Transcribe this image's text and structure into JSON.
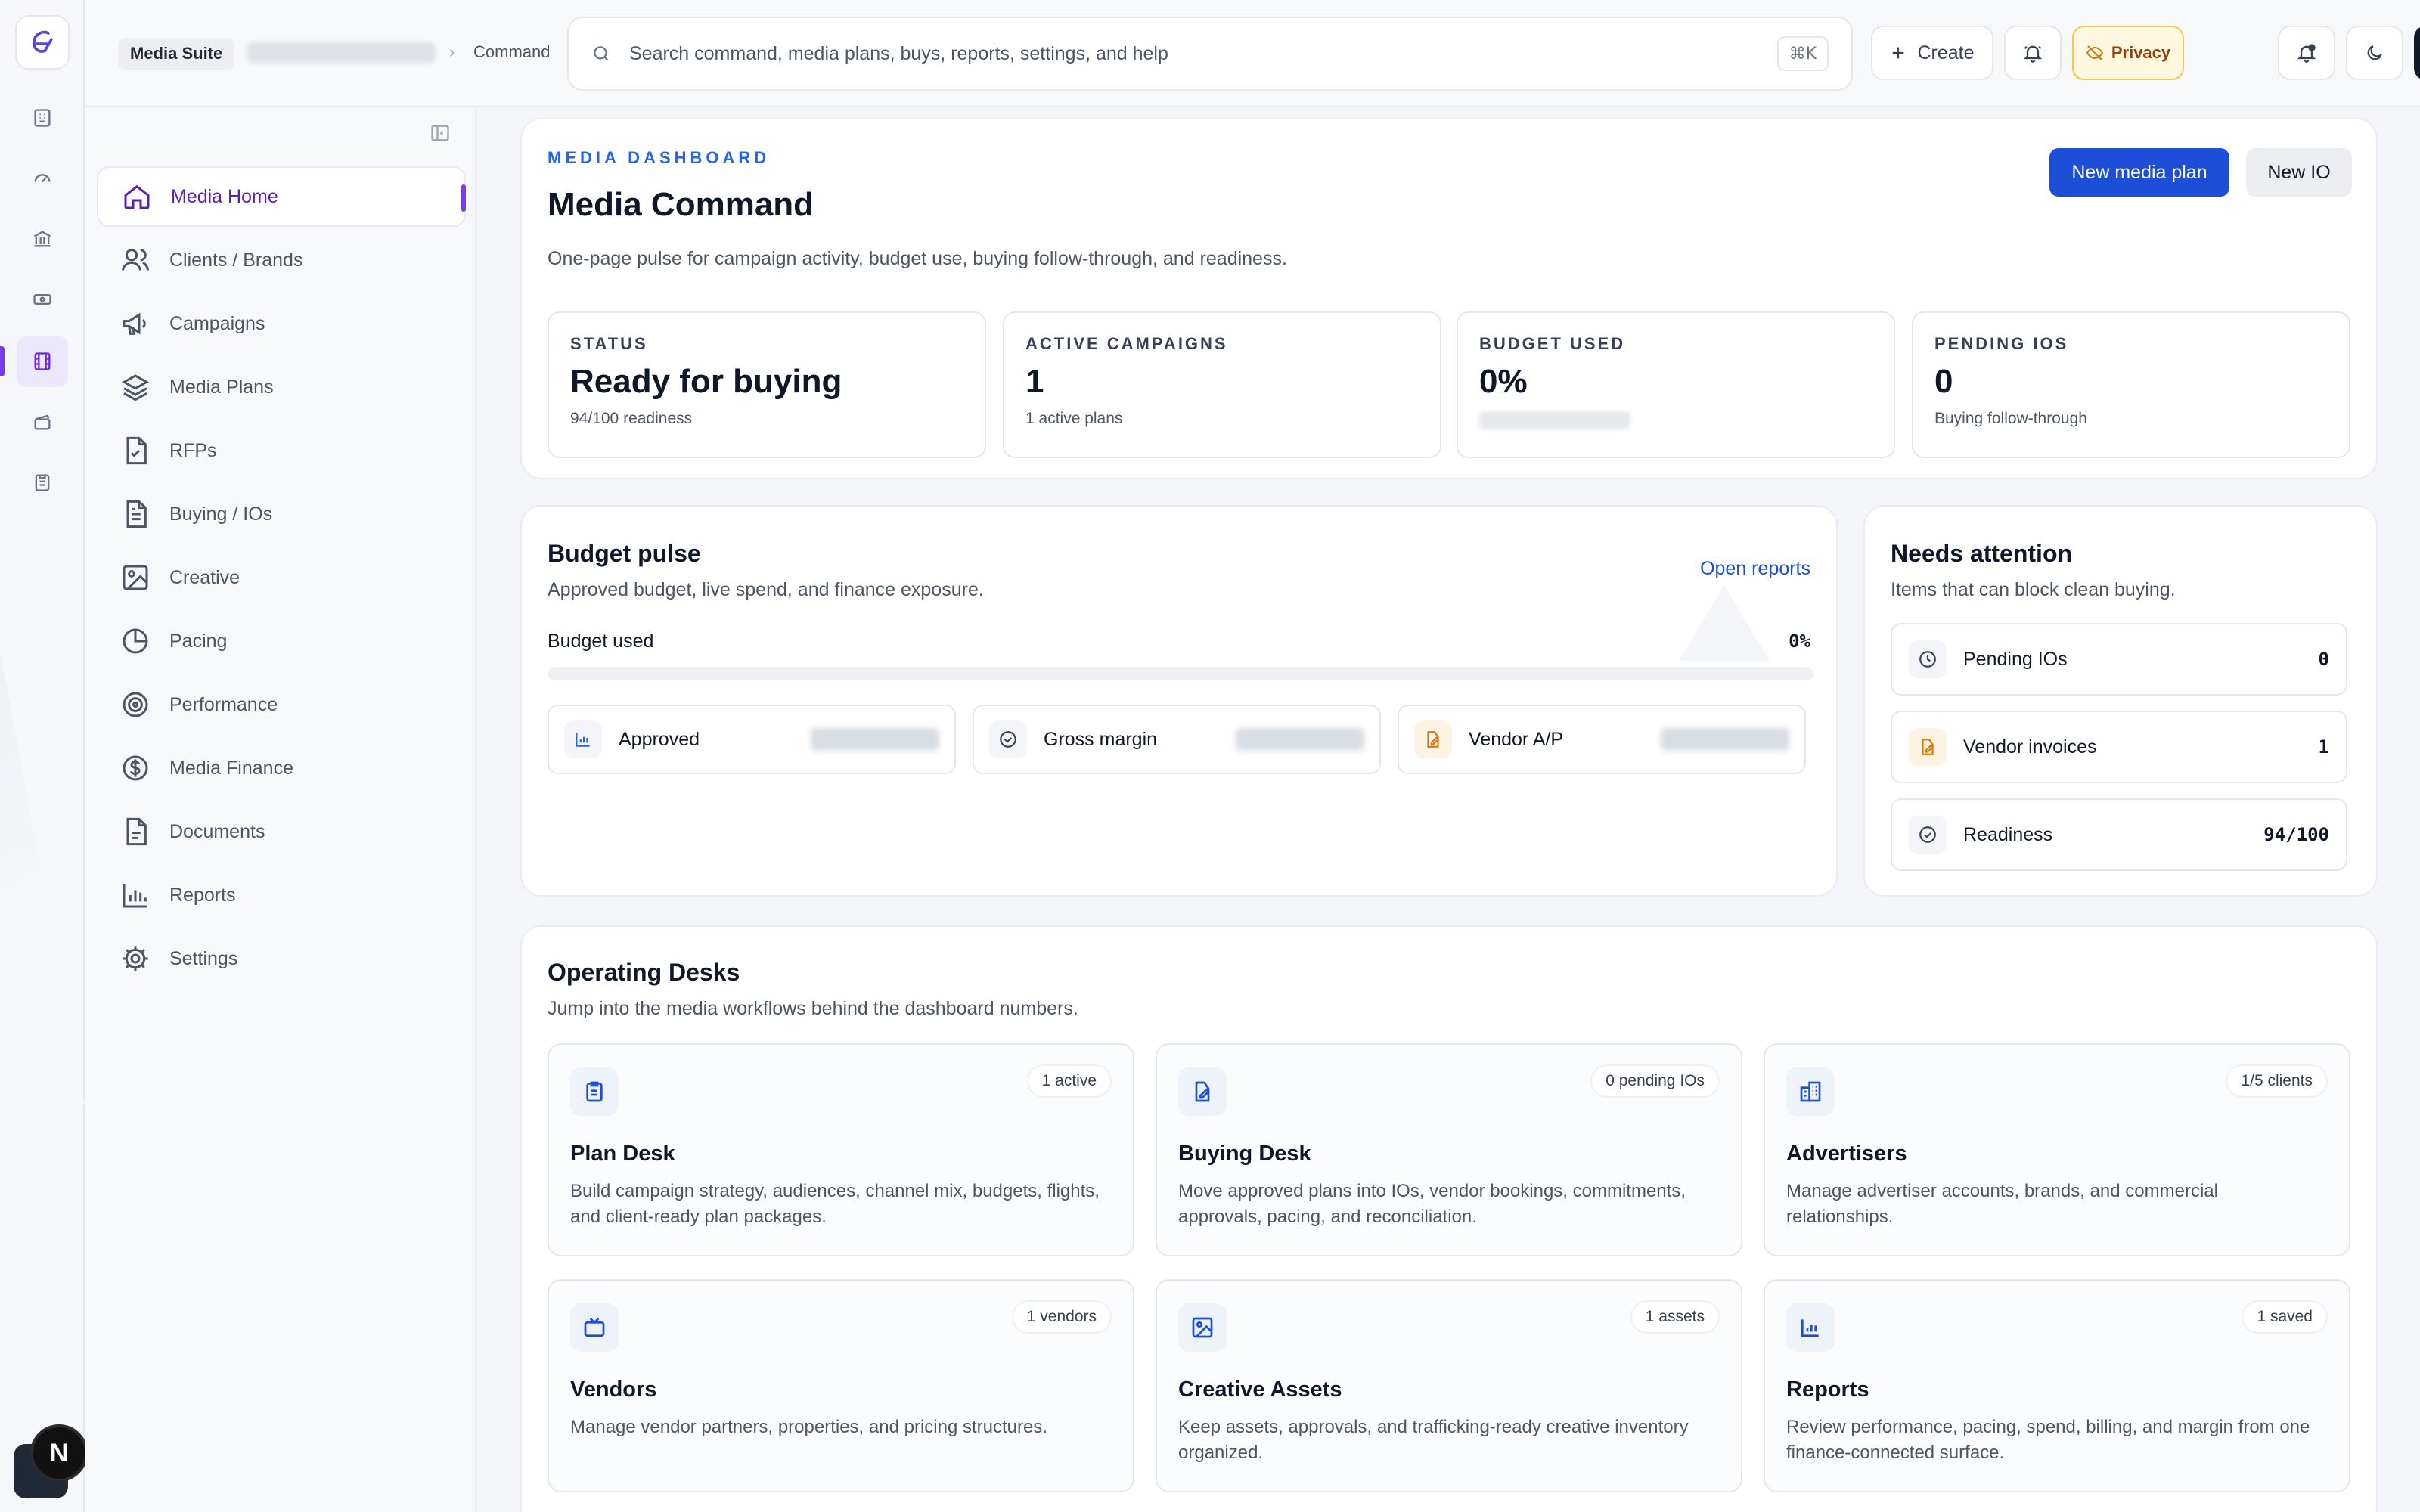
{
  "topbar": {
    "app_name": "Media Suite",
    "breadcrumb_separator": "›",
    "breadcrumb_current": "Command",
    "search_placeholder": "Search command, media plans, buys, reports, settings, and help",
    "search_shortcut": "⌘K",
    "create_label": "Create",
    "privacy_label": "Privacy"
  },
  "rail": {
    "icons": [
      "building-icon",
      "gauge-icon",
      "bank-icon",
      "ticket-icon",
      "film-icon",
      "clapperboard-icon",
      "clipboard-icon"
    ],
    "active_index": 4,
    "avatar_letter": "N"
  },
  "sidebar": {
    "items": [
      {
        "label": "Media Home",
        "icon": "home-icon",
        "active": true
      },
      {
        "label": "Clients / Brands",
        "icon": "users-icon"
      },
      {
        "label": "Campaigns",
        "icon": "megaphone-icon"
      },
      {
        "label": "Media Plans",
        "icon": "layers-icon"
      },
      {
        "label": "RFPs",
        "icon": "file-check-icon"
      },
      {
        "label": "Buying / IOs",
        "icon": "file-text-icon"
      },
      {
        "label": "Creative",
        "icon": "image-icon"
      },
      {
        "label": "Pacing",
        "icon": "pie-chart-icon"
      },
      {
        "label": "Performance",
        "icon": "target-icon"
      },
      {
        "label": "Media Finance",
        "icon": "dollar-icon"
      },
      {
        "label": "Documents",
        "icon": "document-icon"
      },
      {
        "label": "Reports",
        "icon": "bar-chart-icon"
      },
      {
        "label": "Settings",
        "icon": "gear-icon"
      }
    ]
  },
  "dashboard": {
    "eyebrow": "MEDIA DASHBOARD",
    "title": "Media Command",
    "subtitle": "One-page pulse for campaign activity, budget use, buying follow-through, and readiness.",
    "new_plan_label": "New media plan",
    "new_io_label": "New IO",
    "stats": [
      {
        "label": "STATUS",
        "value": "Ready for buying",
        "note": "94/100 readiness"
      },
      {
        "label": "ACTIVE CAMPAIGNS",
        "value": "1",
        "note": "1 active plans"
      },
      {
        "label": "BUDGET USED",
        "value": "0%",
        "note": ""
      },
      {
        "label": "PENDING IOS",
        "value": "0",
        "note": "Buying follow-through"
      }
    ]
  },
  "budget_pulse": {
    "title": "Budget pulse",
    "subtitle": "Approved budget, live spend, and finance exposure.",
    "link": "Open reports",
    "used_label": "Budget used",
    "used_value": "0%",
    "used_fraction": 0,
    "minis": [
      {
        "label": "Approved",
        "icon": "bar-chart-icon"
      },
      {
        "label": "Gross margin",
        "icon": "check-circle-icon"
      },
      {
        "label": "Vendor A/P",
        "icon": "edit-file-icon"
      }
    ]
  },
  "needs_attention": {
    "title": "Needs attention",
    "subtitle": "Items that can block clean buying.",
    "items": [
      {
        "label": "Pending IOs",
        "value": "0",
        "icon": "clock-icon"
      },
      {
        "label": "Vendor invoices",
        "value": "1",
        "icon": "edit-file-icon"
      },
      {
        "label": "Readiness",
        "value": "94/100",
        "icon": "check-circle-icon"
      }
    ]
  },
  "desks": {
    "title": "Operating Desks",
    "subtitle": "Jump into the media workflows behind the dashboard numbers.",
    "items": [
      {
        "title": "Plan Desk",
        "badge": "1 active",
        "icon": "clipboard-icon",
        "desc": "Build campaign strategy, audiences, channel mix, budgets, flights, and client-ready plan packages."
      },
      {
        "title": "Buying Desk",
        "badge": "0 pending IOs",
        "icon": "edit-file-icon",
        "desc": "Move approved plans into IOs, vendor bookings, commitments, approvals, pacing, and reconciliation."
      },
      {
        "title": "Advertisers",
        "badge": "1/5 clients",
        "icon": "buildings-icon",
        "desc": "Manage advertiser accounts, brands, and commercial relationships."
      },
      {
        "title": "Vendors",
        "badge": "1 vendors",
        "icon": "tv-icon",
        "desc": "Manage vendor partners, properties, and pricing structures."
      },
      {
        "title": "Creative Assets",
        "badge": "1 assets",
        "icon": "image-icon",
        "desc": "Keep assets, approvals, and trafficking-ready creative inventory organized."
      },
      {
        "title": "Reports",
        "badge": "1 saved",
        "icon": "bar-chart-icon",
        "desc": "Review performance, pacing, spend, billing, and margin from one finance-connected surface."
      }
    ]
  },
  "colors": {
    "accent_purple": "#7c3aed",
    "primary_blue": "#1d4ed8",
    "privacy_bg": "#fff8e1",
    "orange_icon": "#d97706"
  }
}
